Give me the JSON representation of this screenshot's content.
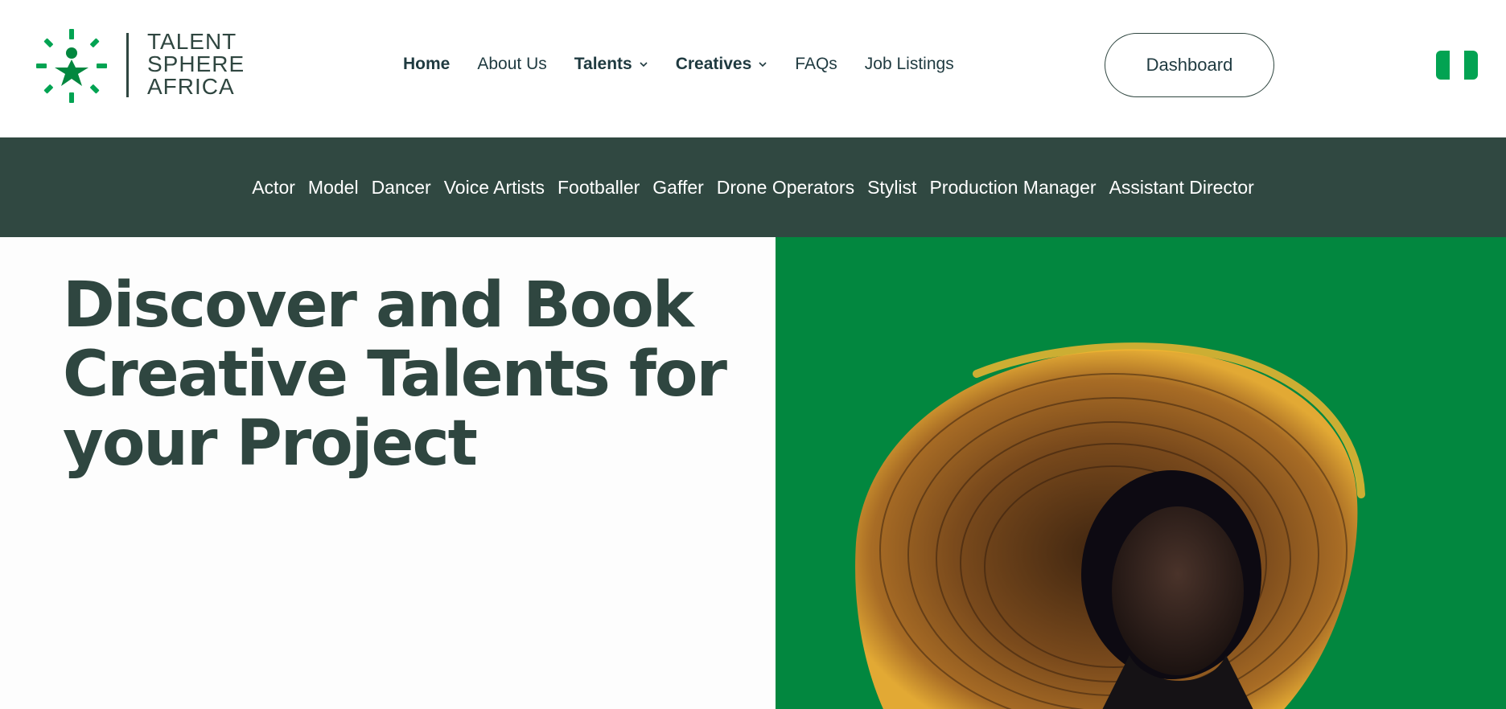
{
  "brand": {
    "name_lines": [
      "TALENT",
      "SPHERE",
      "AFRICA"
    ],
    "logo_icon": "star-person-sunburst",
    "color_primary": "#02873f",
    "color_dark": "#304841"
  },
  "nav": {
    "items": [
      {
        "label": "Home",
        "active": true,
        "dropdown": false
      },
      {
        "label": "About Us",
        "active": false,
        "dropdown": false
      },
      {
        "label": "Talents",
        "active": false,
        "dropdown": true
      },
      {
        "label": "Creatives",
        "active": false,
        "dropdown": true
      },
      {
        "label": "FAQs",
        "active": false,
        "dropdown": false
      },
      {
        "label": "Job Listings",
        "active": false,
        "dropdown": false
      }
    ],
    "dashboard_label": "Dashboard",
    "flag_icon": "nigeria-flag",
    "flag_colors": [
      "#02a352",
      "#ffffff",
      "#02a352"
    ]
  },
  "categories": [
    "Actor",
    "Model",
    "Dancer",
    "Voice Artists",
    "Footballer",
    "Gaffer",
    "Drone Operators",
    "Stylist",
    "Production Manager",
    "Assistant Director"
  ],
  "hero": {
    "title_lines": [
      "Discover and Book",
      "Creative Talents for",
      "your Project"
    ],
    "image_icon": "woman-in-wide-straw-hat",
    "image_background": "#02873f"
  }
}
